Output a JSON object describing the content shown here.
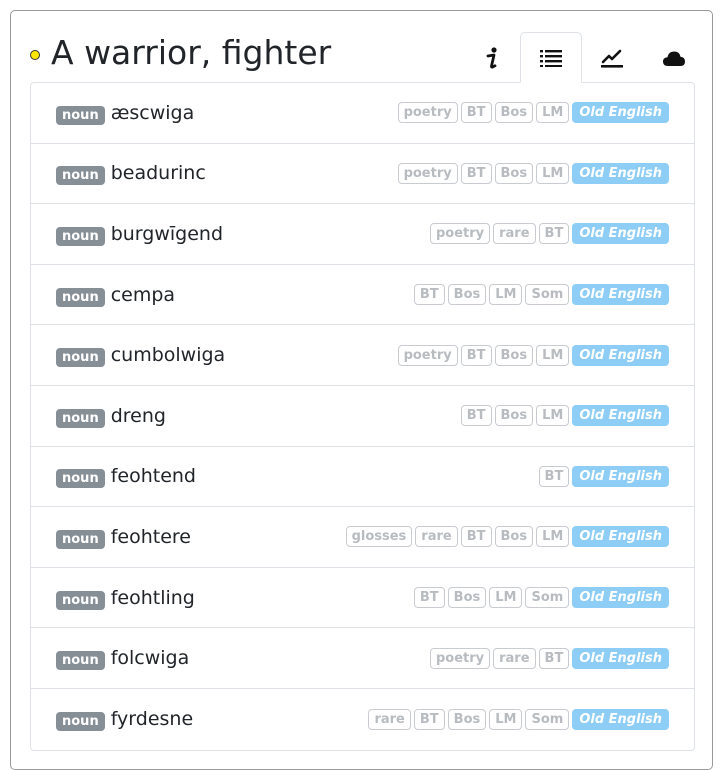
{
  "header": {
    "title": "A warrior, fighter",
    "tabs": [
      {
        "name": "info",
        "icon": "info-icon",
        "glyph": "i"
      },
      {
        "name": "list",
        "icon": "list-icon",
        "active": true
      },
      {
        "name": "chart",
        "icon": "chart-line-icon"
      },
      {
        "name": "cloud",
        "icon": "cloud-icon"
      }
    ]
  },
  "entries": [
    {
      "pos": "noun",
      "word": "æscwiga",
      "tags": [
        "poetry",
        "BT",
        "Bos",
        "LM"
      ],
      "language": "Old English"
    },
    {
      "pos": "noun",
      "word": "beadurinc",
      "tags": [
        "poetry",
        "BT",
        "Bos",
        "LM"
      ],
      "language": "Old English"
    },
    {
      "pos": "noun",
      "word": "burgwīgend",
      "tags": [
        "poetry",
        "rare",
        "BT"
      ],
      "language": "Old English"
    },
    {
      "pos": "noun",
      "word": "cempa",
      "tags": [
        "BT",
        "Bos",
        "LM",
        "Som"
      ],
      "language": "Old English"
    },
    {
      "pos": "noun",
      "word": "cumbolwiga",
      "tags": [
        "poetry",
        "BT",
        "Bos",
        "LM"
      ],
      "language": "Old English"
    },
    {
      "pos": "noun",
      "word": "dreng",
      "tags": [
        "BT",
        "Bos",
        "LM"
      ],
      "language": "Old English"
    },
    {
      "pos": "noun",
      "word": "feohtend",
      "tags": [
        "BT"
      ],
      "language": "Old English"
    },
    {
      "pos": "noun",
      "word": "feohtere",
      "tags": [
        "glosses",
        "rare",
        "BT",
        "Bos",
        "LM"
      ],
      "language": "Old English"
    },
    {
      "pos": "noun",
      "word": "feohtling",
      "tags": [
        "BT",
        "Bos",
        "LM",
        "Som"
      ],
      "language": "Old English"
    },
    {
      "pos": "noun",
      "word": "folcwiga",
      "tags": [
        "poetry",
        "rare",
        "BT"
      ],
      "language": "Old English"
    },
    {
      "pos": "noun",
      "word": "fyrdesne",
      "tags": [
        "rare",
        "BT",
        "Bos",
        "LM",
        "Som"
      ],
      "language": "Old English"
    }
  ],
  "colors": {
    "pos_badge": "#868e96",
    "language_badge": "#8ecdf5",
    "tag_text": "#b8bcc0",
    "status_dot": "#ffe600"
  }
}
